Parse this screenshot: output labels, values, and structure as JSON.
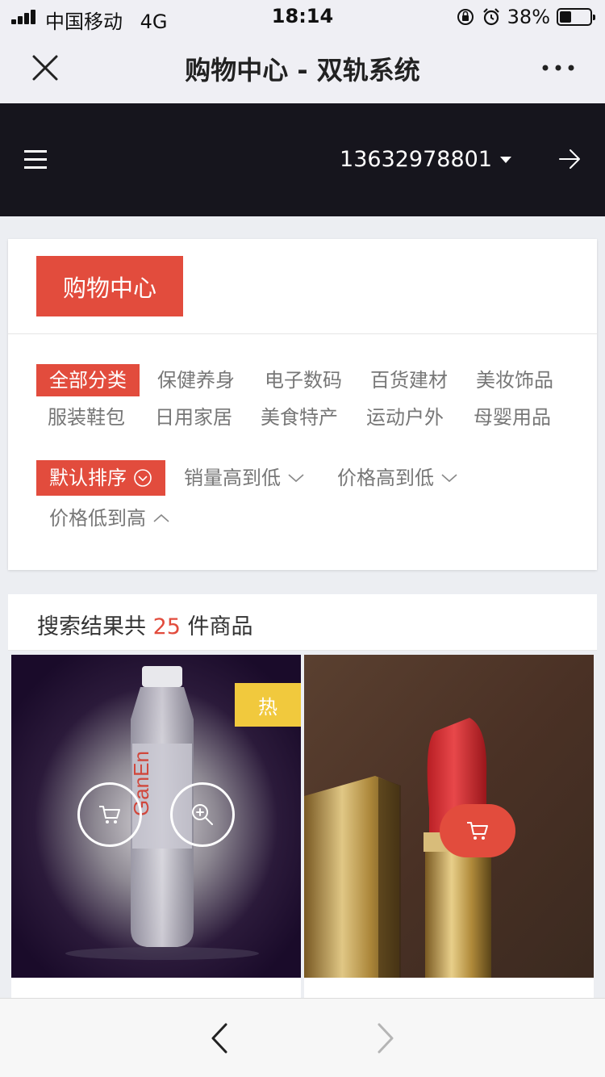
{
  "status_bar": {
    "carrier": "中国移动",
    "network": "4G",
    "time": "18:14",
    "battery_percent": "38%",
    "battery_level": 0.38
  },
  "nav_bar": {
    "title": "购物中心 - 双轨系统",
    "close_icon": "close-icon",
    "more_icon": "more-icon"
  },
  "header": {
    "account": "13632978801",
    "menu_icon": "menu-icon",
    "logout_icon": "arrow-right-icon"
  },
  "filter": {
    "tab": "购物中心",
    "categories": [
      "全部分类",
      "保健养身",
      "电子数码",
      "百货建材",
      "美妆饰品",
      "服装鞋包",
      "日用家居",
      "美食特产",
      "运动户外",
      "母婴用品"
    ],
    "active_category": "全部分类",
    "sorts": [
      "默认排序",
      "销量高到低",
      "价格高到低",
      "价格低到高"
    ],
    "active_sort": "默认排序"
  },
  "results": {
    "prefix": "搜索结果共",
    "count": "25",
    "suffix": "件商品"
  },
  "products": [
    {
      "badge": "热",
      "image": "water-bottle",
      "actions": [
        "cart-icon",
        "zoom-icon"
      ]
    },
    {
      "image": "lipstick",
      "actions": [
        "cart-icon"
      ]
    }
  ],
  "colors": {
    "accent": "#e24c3d",
    "hot_badge": "#f1c93d",
    "header_bg": "#16151d"
  }
}
